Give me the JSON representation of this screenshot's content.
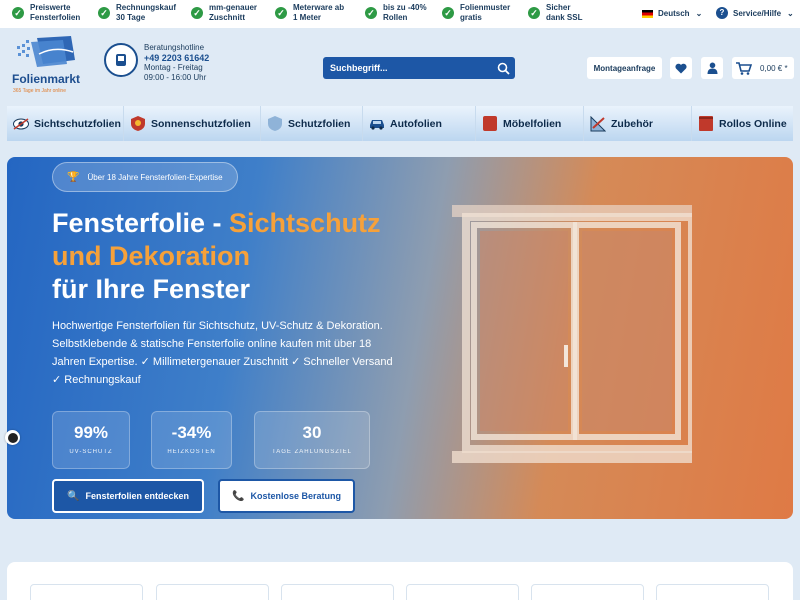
{
  "usps": [
    {
      "line1": "Preiswerte",
      "line2": "Fensterfolien"
    },
    {
      "line1": "Rechnungskauf",
      "line2": "30 Tage"
    },
    {
      "line1": "mm-genauer",
      "line2": "Zuschnitt"
    },
    {
      "line1": "Meterware ab",
      "line2": "1 Meter"
    },
    {
      "line1": "bis zu -40%",
      "line2": "Rollen"
    },
    {
      "line1": "Folienmuster",
      "line2": "gratis"
    },
    {
      "line1": "Sicher",
      "line2": "dank SSL"
    }
  ],
  "language": "Deutsch",
  "service": "Service/Hilfe",
  "logo": {
    "name": "Folienmarkt",
    "tagline": "365 Tage im Jahr online"
  },
  "hotline": {
    "label": "Beratungshotline",
    "number": "+49 2203 61642",
    "days": "Montag - Freitag",
    "hours": "09:00 - 16:00 Uhr"
  },
  "search": {
    "placeholder": "Suchbegriff..."
  },
  "header": {
    "montage": "Montageanfrage",
    "cart_total": "0,00 € *"
  },
  "nav": [
    {
      "label": "Sichtschutzfolien",
      "icon": "eye-icon"
    },
    {
      "label": "Sonnenschutzfolien",
      "icon": "sun-shield-icon"
    },
    {
      "label": "Schutzfolien",
      "icon": "shield-icon"
    },
    {
      "label": "Autofolien",
      "icon": "car-icon"
    },
    {
      "label": "Möbelfolien",
      "icon": "furniture-icon"
    },
    {
      "label": "Zubehör",
      "icon": "ruler-icon"
    },
    {
      "label": "Rollos Online",
      "icon": "blind-icon"
    }
  ],
  "hero": {
    "badge": "Über 18 Jahre Fensterfolien-Expertise",
    "title_a": "Fensterfolie - ",
    "title_accent_1": "Sichtschutz",
    "title_accent_2": "und Dekoration",
    "title_b": "für Ihre Fenster",
    "text": "Hochwertige Fensterfolien für Sichtschutz, UV-Schutz & Dekoration. Selbstklebende & statische Fensterfolie online kaufen mit über 18 Jahren Expertise. ✓ Millimetergenauer Zuschnitt ✓ Schneller Versand ✓ Rechnungskauf",
    "stats": [
      {
        "value": "99%",
        "label": "UV-SCHUTZ"
      },
      {
        "value": "-34%",
        "label": "HEIZKOSTEN"
      },
      {
        "value": "30",
        "label": "TAGE ZAHLUNGSZIEL"
      }
    ],
    "cta_primary": "Fensterfolien entdecken",
    "cta_secondary": "Kostenlose Beratung"
  },
  "colors": {
    "brand_blue": "#1d57a6",
    "accent_orange": "#f6a13a",
    "check_green": "#2e9a45"
  }
}
